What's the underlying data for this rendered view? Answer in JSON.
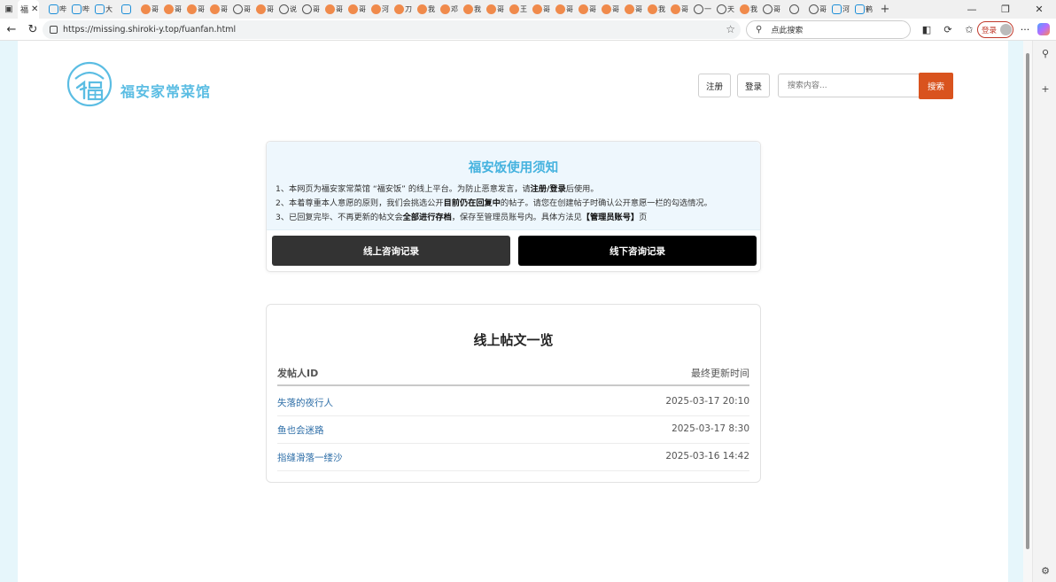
{
  "browser": {
    "active_tab_label": "福",
    "mini_tabs": [
      {
        "icon": "bilibili-icon",
        "text": "哔"
      },
      {
        "icon": "bilibili-icon",
        "text": "哔"
      },
      {
        "icon": "bilibili-icon",
        "text": "大"
      },
      {
        "icon": "bilibili-icon",
        "text": ""
      },
      {
        "icon": "orange-site-icon",
        "text": "哥"
      },
      {
        "icon": "orange-site-icon",
        "text": "哥"
      },
      {
        "icon": "orange-site-icon",
        "text": "哥"
      },
      {
        "icon": "orange-site-icon",
        "text": "哥"
      },
      {
        "icon": "globe-icon",
        "text": "哥"
      },
      {
        "icon": "orange-site-icon",
        "text": "哥"
      },
      {
        "icon": "globe-icon",
        "text": "说"
      },
      {
        "icon": "globe-icon",
        "text": "哥"
      },
      {
        "icon": "orange-site-icon",
        "text": "哥"
      },
      {
        "icon": "orange-site-icon",
        "text": "哥"
      },
      {
        "icon": "orange-site-icon",
        "text": "河"
      },
      {
        "icon": "orange-site-icon",
        "text": "刀"
      },
      {
        "icon": "orange-site-icon",
        "text": "我"
      },
      {
        "icon": "orange-site-icon",
        "text": "邓"
      },
      {
        "icon": "orange-site-icon",
        "text": "我"
      },
      {
        "icon": "orange-site-icon",
        "text": "哥"
      },
      {
        "icon": "orange-site-icon",
        "text": "王"
      },
      {
        "icon": "orange-site-icon",
        "text": "哥"
      },
      {
        "icon": "orange-site-icon",
        "text": "哥"
      },
      {
        "icon": "orange-site-icon",
        "text": "哥"
      },
      {
        "icon": "orange-site-icon",
        "text": "哥"
      },
      {
        "icon": "orange-site-icon",
        "text": "哥"
      },
      {
        "icon": "orange-site-icon",
        "text": "我"
      },
      {
        "icon": "orange-site-icon",
        "text": "哥"
      },
      {
        "icon": "globe-icon",
        "text": "一"
      },
      {
        "icon": "globe-icon",
        "text": "天"
      },
      {
        "icon": "orange-site-icon",
        "text": "我"
      },
      {
        "icon": "globe-icon",
        "text": "哥"
      },
      {
        "icon": "globe-icon",
        "text": ""
      },
      {
        "icon": "github-icon",
        "text": "哥"
      },
      {
        "icon": "search-icon",
        "text": "河"
      },
      {
        "icon": "zhihu-icon",
        "text": "鹤"
      }
    ],
    "url": "https://missing.shiroki-y.top/fuanfan.html",
    "search_placeholder": "点此搜索",
    "login_label": "登录"
  },
  "header": {
    "brand": "福安家常菜馆",
    "register_label": "注册",
    "login_label": "登录",
    "search_placeholder": "搜索内容...",
    "search_button": "搜索",
    "colors": {
      "brand": "#5bbde3",
      "search_button": "#d9531e"
    }
  },
  "notice": {
    "title": "福安饭使用须知",
    "line1_a": "1、本网页为福安家常菜馆 “福安饭” 的线上平台。为防止恶意发言，请",
    "line1_b": "注册/登录",
    "line1_c": "后使用。",
    "line2_a": "2、本着尊重本人意愿的原则，我们会挑选公开",
    "line2_b": "目前仍在回复中",
    "line2_c": "的帖子。请您在创建帖子时确认公开意愿一栏的勾选情况。",
    "line3_a": "3、已回复完毕、不再更新的帖文会",
    "line3_b": "全部进行存档",
    "line3_c": "，保存至管理员账号内。具体方法见",
    "line3_d": "【管理员账号】",
    "line3_e": "页"
  },
  "buttons": {
    "online": "线上咨询记录",
    "offline": "线下咨询记录"
  },
  "posts": {
    "title": "线上帖文一览",
    "col_id": "发帖人ID",
    "col_time": "最终更新时间",
    "rows": [
      {
        "id": "失落的夜行人",
        "time": "2025-03-17 20:10"
      },
      {
        "id": "鱼也会迷路",
        "time": "2025-03-17 8:30"
      },
      {
        "id": "指缝滑落一缕沙",
        "time": "2025-03-16 14:42"
      }
    ]
  }
}
